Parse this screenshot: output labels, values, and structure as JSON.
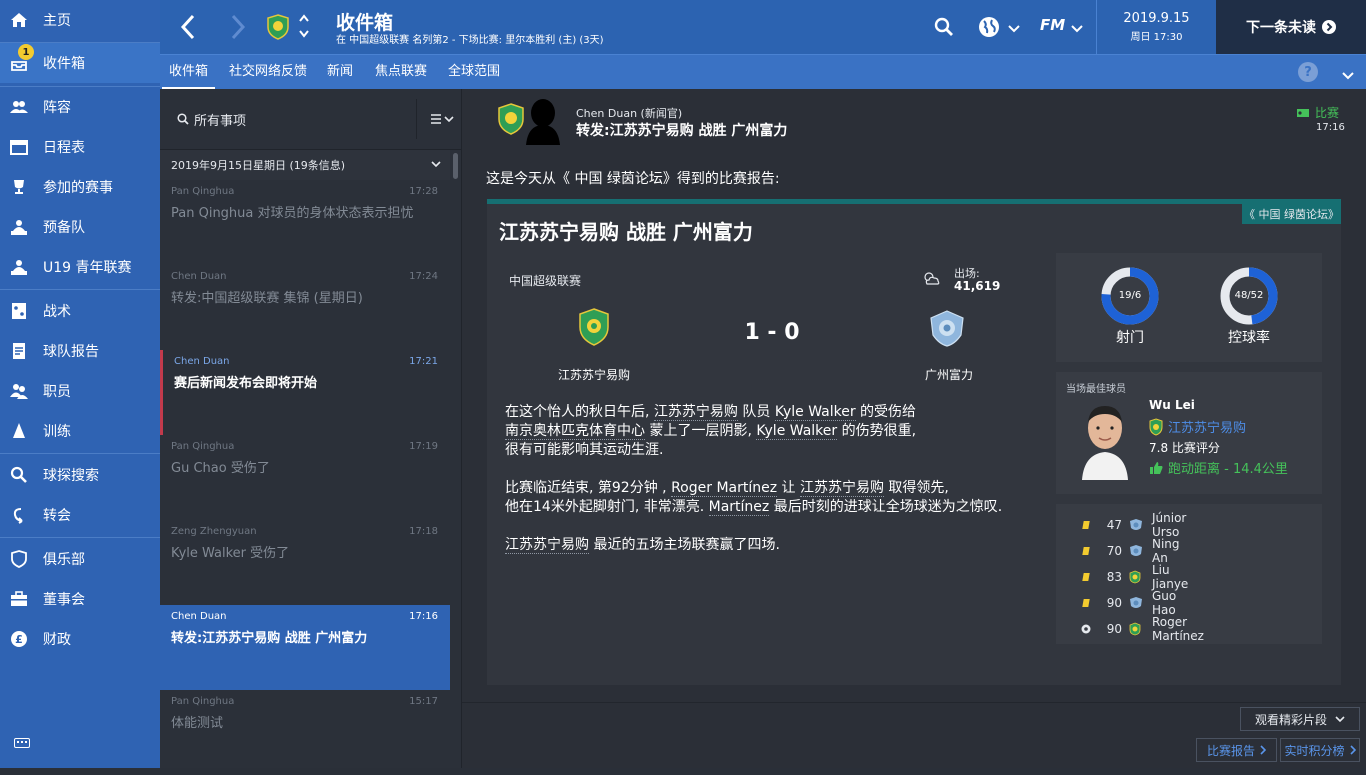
{
  "sidebar": {
    "items": [
      {
        "label": "主页",
        "icon": "home-icon"
      },
      {
        "label": "收件箱",
        "icon": "inbox-icon",
        "badge": "1",
        "active": true
      },
      {
        "label": "阵容",
        "icon": "squad-icon"
      },
      {
        "label": "日程表",
        "icon": "calendar-icon"
      },
      {
        "label": "参加的赛事",
        "icon": "trophy-icon"
      },
      {
        "label": "预备队",
        "icon": "reserves-icon"
      },
      {
        "label": "U19 青年联赛",
        "icon": "youth-icon"
      },
      {
        "label": "战术",
        "icon": "tactics-icon"
      },
      {
        "label": "球队报告",
        "icon": "report-icon"
      },
      {
        "label": "职员",
        "icon": "staff-icon"
      },
      {
        "label": "训练",
        "icon": "training-icon"
      },
      {
        "label": "球探搜索",
        "icon": "scouting-icon"
      },
      {
        "label": "转会",
        "icon": "transfer-icon"
      },
      {
        "label": "俱乐部",
        "icon": "club-icon"
      },
      {
        "label": "董事会",
        "icon": "board-icon"
      },
      {
        "label": "财政",
        "icon": "finance-icon"
      }
    ]
  },
  "header": {
    "title": "收件箱",
    "subtitle": "在 中国超级联赛 名列第2 - 下场比赛: 里尔本胜利 (主) (3天)",
    "date": "2019.9.15",
    "weekday_time": "周日 17:30",
    "next_label": "下一条未读",
    "fm_label": "FM"
  },
  "tabs": [
    "收件箱",
    "社交网络反馈",
    "新闻",
    "焦点联赛",
    "全球范围"
  ],
  "list": {
    "search_label": "所有事项",
    "group_label": "2019年9月15日星期日 (19条信息)",
    "messages": [
      {
        "sender": "Pan Qinghua",
        "time": "17:28",
        "subject": "Pan Qinghua 对球员的身体状态表示担忧"
      },
      {
        "sender": "Chen Duan",
        "time": "17:24",
        "subject": "转发:中国超级联赛 集锦 (星期日)"
      },
      {
        "sender": "Chen Duan",
        "time": "17:21",
        "subject": "赛后新闻发布会即将开始"
      },
      {
        "sender": "Pan Qinghua",
        "time": "17:19",
        "subject": "Gu Chao 受伤了"
      },
      {
        "sender": "Zeng Zhengyuan",
        "time": "17:18",
        "subject": "Kyle Walker 受伤了"
      },
      {
        "sender": "Chen Duan",
        "time": "17:16",
        "subject": "转发:江苏苏宁易购 战胜 广州富力"
      },
      {
        "sender": "Pan Qinghua",
        "time": "15:17",
        "subject": "体能测试"
      }
    ]
  },
  "message": {
    "from": "Chen Duan  (新闻官)",
    "subject": "转发:江苏苏宁易购 战胜 广州富力",
    "tag": "比赛",
    "time": "17:16",
    "intro": "这是今天从《 中国 绿茵论坛》得到的比赛报告:",
    "source": "《 中国 绿茵论坛》",
    "headline": "江苏苏宁易购 战胜 广州富力",
    "competition": "中国超级联赛",
    "attendance_label": "出场:",
    "attendance": "41,619",
    "score": "1 - 0",
    "home": "江苏苏宁易购",
    "away": "广州富力",
    "p1a": "在这个怡人的秋日午后, ",
    "p1b": "江苏苏宁易购",
    "p1c": " 队员 ",
    "p1d": "Kyle Walker",
    "p1e": " 的受伤给",
    "p1f": "南京奥林匹克体育中心",
    "p1g": " 蒙上了一层阴影, ",
    "p1h": "Kyle Walker",
    "p1i": " 的伤势很重,",
    "p1j": "很有可能影响其运动生涯.",
    "p2a": "比赛临近结束, 第92分钟 , ",
    "p2b": "Roger Martínez",
    "p2c": " 让 ",
    "p2d": "江苏苏宁易购",
    "p2e": " 取得领先,",
    "p2f": "他在14米外起脚射门, 非常漂亮. ",
    "p2g": "Martínez",
    "p2h": " 最后时刻的进球让全场球迷为之惊叹.",
    "p3a": "江苏苏宁易购",
    "p3b": " 最近的五场主场联赛赢了四场.",
    "stats": [
      {
        "value": "19/6",
        "label": "射门",
        "fraction": 0.76
      },
      {
        "value": "48/52",
        "label": "控球率",
        "fraction": 0.48
      }
    ],
    "motm": {
      "title": "当场最佳球员",
      "name": "Wu Lei",
      "club": "江苏苏宁易购",
      "rating": "7.8 比赛评分",
      "distance": "跑动距离 - 14.4公里"
    },
    "events": [
      {
        "type": "yellow-card",
        "minute": "47",
        "team": "away",
        "player": "Júnior Urso"
      },
      {
        "type": "yellow-card",
        "minute": "70",
        "team": "away",
        "player": "Ning An"
      },
      {
        "type": "yellow-card",
        "minute": "83",
        "team": "home",
        "player": "Liu Jianye"
      },
      {
        "type": "yellow-card",
        "minute": "90",
        "team": "away",
        "player": "Guo Hao"
      },
      {
        "type": "goal",
        "minute": "90",
        "team": "home",
        "player": "Roger Martínez"
      }
    ]
  },
  "footer": {
    "highlights": "观看精彩片段",
    "match_report": "比赛报告",
    "live_table": "实时积分榜"
  },
  "colors": {
    "accent": "#2f63b3",
    "teal": "#166f72",
    "positive": "#45c25a",
    "card": "#f3cb2f"
  }
}
